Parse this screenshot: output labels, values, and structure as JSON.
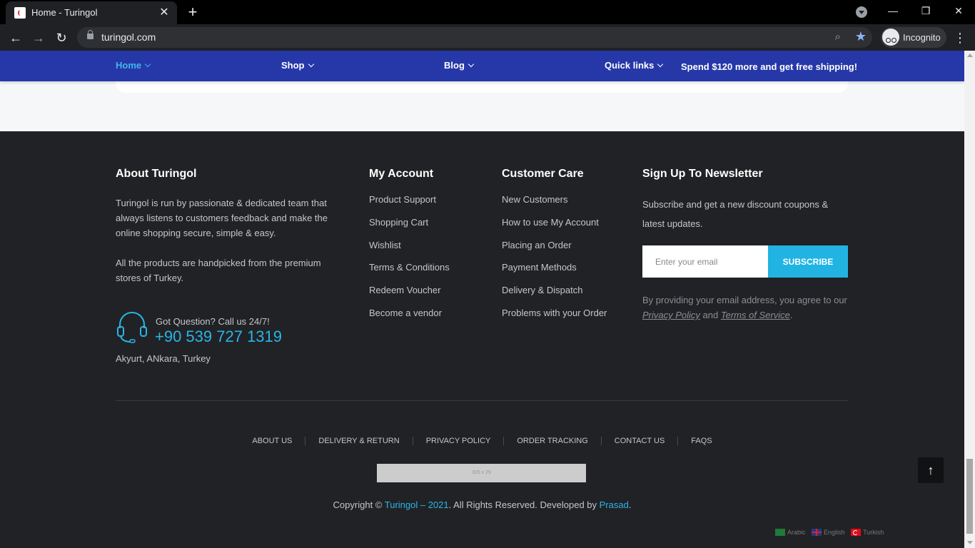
{
  "browser": {
    "tab_title": "Home - Turingol",
    "tab_close": "✕",
    "new_tab": "+",
    "url": "turingol.com",
    "profile_label": "Incognito",
    "window_controls": [
      "—",
      "❐",
      "✕"
    ],
    "icons": [
      "back-icon",
      "forward-icon",
      "reload-icon",
      "lock-icon",
      "zoom-icon",
      "star-icon",
      "incognito-icon",
      "menu-icon"
    ]
  },
  "nav": {
    "items": [
      {
        "label": "Home",
        "active": true
      },
      {
        "label": "Shop",
        "active": false
      },
      {
        "label": "Blog",
        "active": false
      },
      {
        "label": "Quick links",
        "active": false
      }
    ],
    "shipping_notice": "Spend $120 more and get free shipping!"
  },
  "footer": {
    "about": {
      "title": "About Turingol",
      "paragraph1": "Turingol is run by passionate & dedicated team that always listens to customers feedback and make the online shopping secure, simple & easy.",
      "paragraph2": "All the products are handpicked from the premium stores of Turkey.",
      "question": "Got Question? Call us 24/7!",
      "phone": "+90 539 727 1319",
      "address": "Akyurt, ANkara, Turkey"
    },
    "my_account": {
      "title": "My Account",
      "links": [
        "Product Support",
        "Shopping Cart",
        "Wishlist",
        "Terms & Conditions",
        "Redeem Voucher",
        "Become a vendor"
      ]
    },
    "customer_care": {
      "title": "Customer Care",
      "links": [
        "New Customers",
        "How to use My Account",
        "Placing an Order",
        "Payment Methods",
        "Delivery & Dispatch",
        "Problems with your Order"
      ]
    },
    "newsletter": {
      "title": "Sign Up To Newsletter",
      "text": "Subscribe and get a new discount coupons & latest updates.",
      "email_placeholder": "Enter your email",
      "button_label": "SUBSCRIBE",
      "agree_prefix": "By providing your email address, you agree to our ",
      "privacy_link": "Privacy Policy",
      "agree_and": " and ",
      "terms_link": "Terms of Service",
      "agree_suffix": "."
    },
    "bottom_links": [
      "ABOUT US",
      "DELIVERY & RETURN",
      "PRIVACY POLICY",
      "ORDER TRACKING",
      "CONTACT US",
      "FAQS"
    ],
    "placeholder_image_text": "305 x 29",
    "copyright": {
      "prefix": "Copyright © ",
      "brand": "Turingol – 2021",
      "middle": ". All Rights Reserved. Developed by ",
      "developer": "Prasad",
      "suffix": "."
    },
    "back_to_top": "↑",
    "languages": [
      "Arabic",
      "English",
      "Turkish"
    ]
  },
  "colors": {
    "nav_bg": "#2638a8",
    "accent": "#29b6e8",
    "footer_bg": "#212225",
    "subscribe_bg": "#21b4e3"
  }
}
